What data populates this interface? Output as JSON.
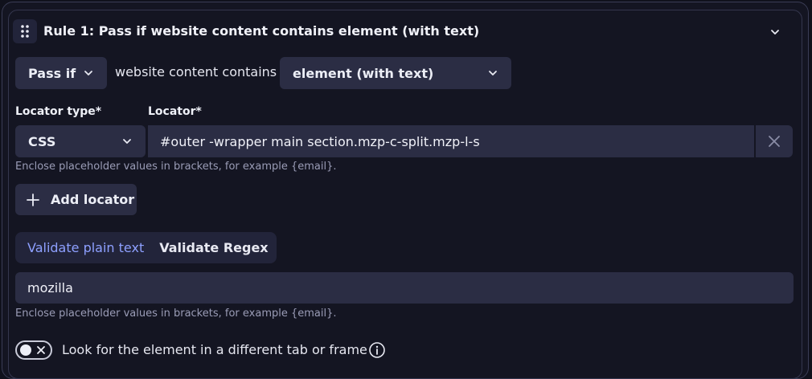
{
  "rule": {
    "title": "Rule 1: Pass if website content contains element (with text)"
  },
  "condition": {
    "mode_value": "Pass if",
    "connector_text": "website content contains",
    "target_value": "element (with text)"
  },
  "locator": {
    "type_label": "Locator type*",
    "type_value": "CSS",
    "label": "Locator*",
    "value": "#outer -wrapper main section.mzp-c-split.mzp-l-s",
    "hint": "Enclose placeholder values in brackets, for example {email}.",
    "add_label": "Add locator"
  },
  "validation": {
    "tabs": [
      "Validate plain text",
      "Validate Regex"
    ],
    "active_tab": 0,
    "value": "mozilla",
    "hint": "Enclose placeholder values in brackets, for example {email}."
  },
  "frame_toggle": {
    "label": "Look for the element in a different tab or frame",
    "on": false
  },
  "colors": {
    "background": "#141522",
    "field": "#2b2d44",
    "accent": "#8ea0ff",
    "border": "#34364e"
  },
  "icons": [
    "drag-handle-icon",
    "chevron-down-icon",
    "close-icon",
    "plus-icon",
    "info-icon",
    "toggle-off-icon"
  ]
}
